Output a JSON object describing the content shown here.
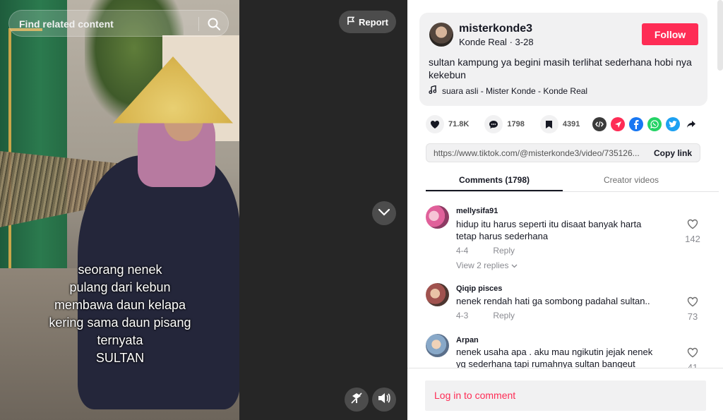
{
  "video": {
    "search_placeholder": "Find related content",
    "report_label": "Report",
    "overlay_lines": [
      "seorang nenek",
      "pulang dari kebun",
      "membawa daun kelapa",
      "kering sama daun pisang",
      "ternyata",
      "SULTAN"
    ]
  },
  "post": {
    "username": "misterkonde3",
    "author_name": "Konde Real",
    "date": "3-28",
    "follow_label": "Follow",
    "description": "sultan kampung ya begini masih terlihat sederhana hobi nya kekebun",
    "music": "suara asli - Mister Konde - Konde Real"
  },
  "stats": {
    "likes": "71.8K",
    "comments": "1798",
    "saves": "4391"
  },
  "share_icons": [
    "embed-icon",
    "send-icon",
    "facebook-icon",
    "whatsapp-icon",
    "twitter-icon",
    "share-arrow-icon"
  ],
  "link": {
    "url": "https://www.tiktok.com/@misterkonde3/video/735126...",
    "copy_label": "Copy link"
  },
  "tabs": {
    "comments": "Comments (1798)",
    "creator_videos": "Creator videos"
  },
  "comments": [
    {
      "user": "mellysifa91",
      "text": "hidup itu harus seperti itu disaat banyak harta tetap harus sederhana",
      "date": "4-4",
      "reply_label": "Reply",
      "likes": "142",
      "replies_label": "View 2 replies"
    },
    {
      "user": "Qiqip pisces",
      "text": "nenek rendah hati ga sombong padahal sultan..",
      "date": "4-3",
      "reply_label": "Reply",
      "likes": "73"
    },
    {
      "user": "Arpan",
      "text": "nenek usaha apa . aku mau ngikutin jejak nenek yg sederhana tapi rumahnya sultan bangeut",
      "likes": "41"
    }
  ],
  "login_label": "Log in to comment",
  "colors": {
    "brand_red": "#fe2c55",
    "text_primary": "#161823",
    "text_secondary": "#8a8b91"
  }
}
